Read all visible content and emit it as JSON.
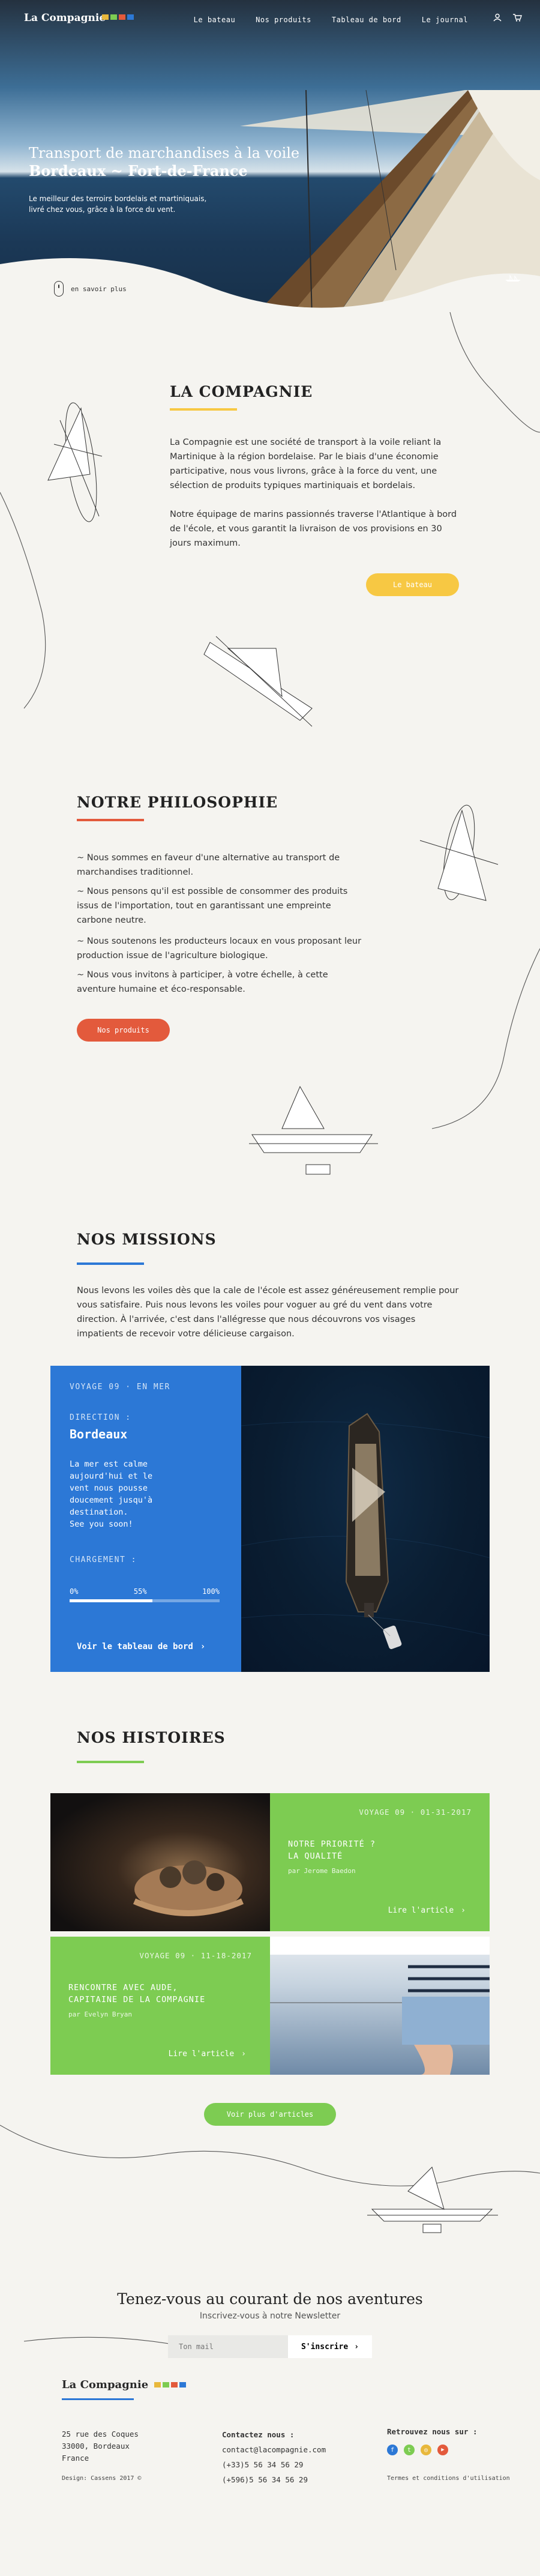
{
  "brand": "La Compagnie",
  "nav": [
    "Le bateau",
    "Nos produits",
    "Tableau de bord",
    "Le journal"
  ],
  "hero": {
    "title_line1": "Transport de marchandises à la voile",
    "title_line2": "Bordeaux ~ Fort-de-France",
    "lead": "Le meilleur des terroirs bordelais et martiniquais, livré chez vous, grâce à la force du vent.",
    "more": "en savoir plus"
  },
  "compagnie": {
    "title": "LA COMPAGNIE",
    "p1": "La Compagnie est une société de transport à la voile reliant la Martinique à la région bordelaise. Par le biais d'une économie participative, nous vous livrons, grâce à la force du vent, une sélection de produits typiques martiniquais et bordelais.",
    "p2": "Notre équipage de marins passionnés traverse l'Atlantique à bord de l'école, et vous garantit la livraison de vos provisions en 30 jours maximum.",
    "button": "Le bateau"
  },
  "philosophie": {
    "title": "NOTRE PHILOSOPHIE",
    "items": [
      "~ Nous sommes en faveur d'une alternative au transport de marchandises traditionnel.",
      "~ Nous pensons qu'il est possible de consommer des produits issus de l'importation, tout en garantissant une empreinte carbone neutre.",
      "~ Nous soutenons les producteurs locaux en vous proposant leur production issue de l'agriculture biologique.",
      "~ Nous vous invitons à participer, à votre échelle, à cette aventure humaine et éco-responsable."
    ],
    "button": "Nos produits"
  },
  "missions": {
    "title": "NOS MISSIONS",
    "text": "Nous levons les voiles dès que la cale de l'école est assez généreusement remplie pour vous satisfaire. Puis nous levons les voiles pour voguer au gré du vent dans votre direction. À l'arrivée, c'est dans l'allégresse que nous découvrons vos visages impatients de recevoir votre délicieuse cargaison.",
    "voyage": "VOYAGE 09 · EN MER",
    "direction_label": "DIRECTION :",
    "direction": "Bordeaux",
    "message": "La mer est calme aujourd'hui et le vent nous pousse doucement jusqu'à destination.\nSee you soon!",
    "loading_label": "CHARGEMENT :",
    "progress": 0.55,
    "ticks": [
      "0%",
      "55%",
      "100%"
    ],
    "link": "Voir le tableau de bord"
  },
  "histoires": {
    "title": "NOS HISTOIRES",
    "stories": [
      {
        "meta": "VOYAGE 09 · 01-31-2017",
        "title": "NOTRE PRIORITÉ ?\nLA QUALITÉ",
        "author": "par Jerome Baedon",
        "link": "Lire l'article"
      },
      {
        "meta": "VOYAGE 09 · 11-18-2017",
        "title": "RENCONTRE AVEC AUDE,\nCAPITAINE DE LA COMPAGNIE",
        "author": "par Evelyn Bryan",
        "link": "Lire l'article"
      }
    ],
    "button": "Voir plus d'articles"
  },
  "newsletter": {
    "title": "Tenez-vous au courant de nos aventures",
    "subtitle": "Inscrivez-vous à notre Newsletter",
    "placeholder": "Ton mail",
    "button": "S'inscrire"
  },
  "footer": {
    "address": [
      "25 rue des Coques",
      "33000, Bordeaux",
      "France"
    ],
    "contact_title": "Contactez nous :",
    "contact": [
      "contact@lacompagnie.com",
      "(+33)5 56 34 56 29",
      "(+596)5 56 34 56 29"
    ],
    "social_title": "Retrouvez nous sur :",
    "design": "Design: Cassens 2017 ©",
    "legal": "Termes et conditions d'utilisation"
  },
  "colors": {
    "yellow": "#f7c843",
    "red": "#e35a3c",
    "blue": "#2c78d6",
    "green": "#7dcc52",
    "flag": [
      "#e8b83c",
      "#7dcc52",
      "#e35a3c",
      "#2c78d6"
    ]
  },
  "icons": [
    "user-icon",
    "cart-icon",
    "mouse-icon",
    "chevron-right-icon",
    "facebook-icon",
    "twitter-icon",
    "instagram-icon",
    "youtube-icon"
  ]
}
